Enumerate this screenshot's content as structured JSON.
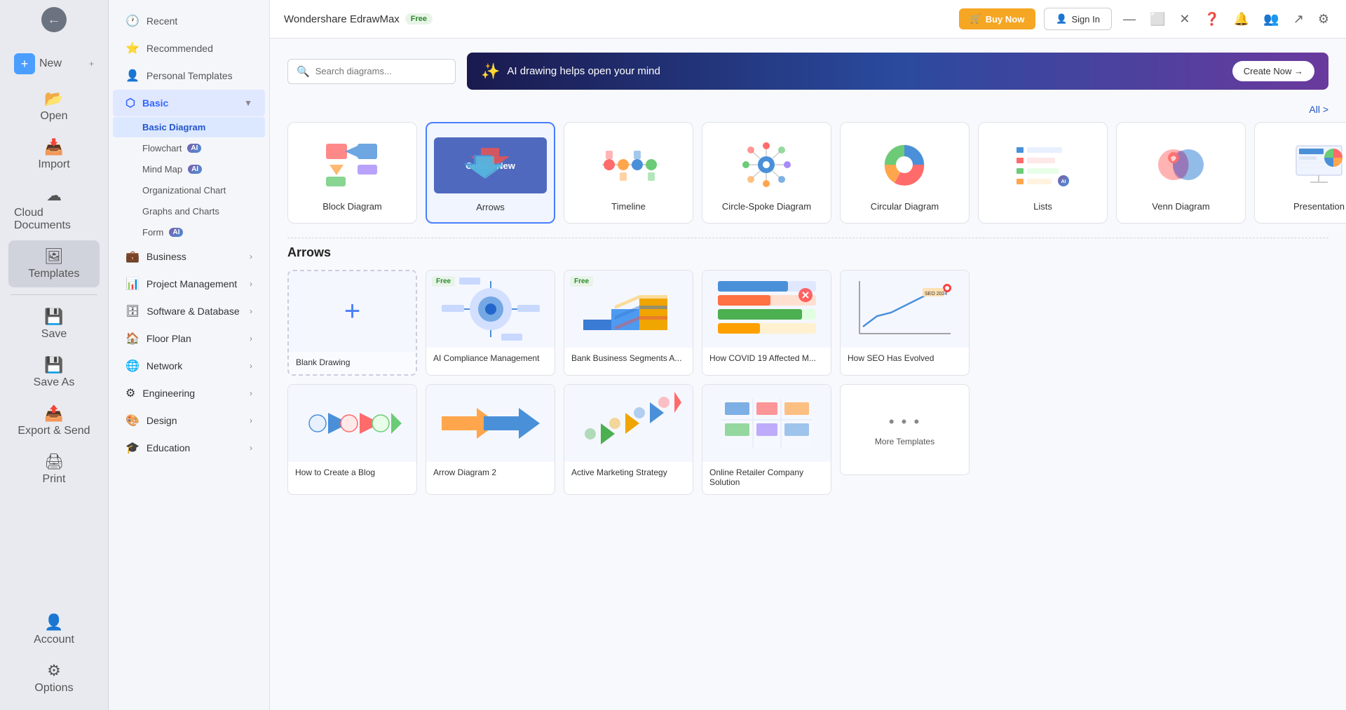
{
  "app": {
    "title": "Wondershare EdrawMax",
    "free_label": "Free",
    "buy_now": "Buy Now",
    "sign_in": "Sign In"
  },
  "search": {
    "placeholder": "Search diagrams..."
  },
  "ai_banner": {
    "text": "AI drawing helps open your mind",
    "cta": "Create Now →"
  },
  "all_link": "All >",
  "icon_nav": [
    {
      "id": "new",
      "label": "New",
      "icon": "✚"
    },
    {
      "id": "open",
      "label": "Open",
      "icon": "📂"
    },
    {
      "id": "import",
      "label": "Import",
      "icon": "📥"
    },
    {
      "id": "cloud",
      "label": "Cloud Documents",
      "icon": "☁"
    },
    {
      "id": "templates",
      "label": "Templates",
      "icon": "🖼"
    },
    {
      "id": "save",
      "label": "Save",
      "icon": "💾"
    },
    {
      "id": "saveas",
      "label": "Save As",
      "icon": "💾"
    },
    {
      "id": "export",
      "label": "Export & Send",
      "icon": "📤"
    },
    {
      "id": "print",
      "label": "Print",
      "icon": "🖨"
    }
  ],
  "nav": {
    "top_items": [
      {
        "id": "recent",
        "label": "Recent",
        "icon": "🕐"
      },
      {
        "id": "recommended",
        "label": "Recommended",
        "icon": "⭐"
      },
      {
        "id": "personal",
        "label": "Personal Templates",
        "icon": "👤"
      }
    ],
    "categories": [
      {
        "id": "basic",
        "label": "Basic",
        "expanded": true,
        "active": true,
        "sub_items": [
          {
            "id": "basic-diagram",
            "label": "Basic Diagram",
            "active": true
          },
          {
            "id": "flowchart",
            "label": "Flowchart",
            "ai": true
          },
          {
            "id": "mind-map",
            "label": "Mind Map",
            "ai": true
          },
          {
            "id": "org-chart",
            "label": "Organizational Chart"
          },
          {
            "id": "graphs",
            "label": "Graphs and Charts"
          },
          {
            "id": "form",
            "label": "Form",
            "ai": true
          }
        ]
      },
      {
        "id": "business",
        "label": "Business",
        "expanded": false
      },
      {
        "id": "project",
        "label": "Project Management",
        "expanded": false
      },
      {
        "id": "software",
        "label": "Software & Database",
        "expanded": false
      },
      {
        "id": "floor",
        "label": "Floor Plan",
        "expanded": false
      },
      {
        "id": "network",
        "label": "Network",
        "expanded": false
      },
      {
        "id": "engineering",
        "label": "Engineering",
        "expanded": false
      },
      {
        "id": "design",
        "label": "Design",
        "expanded": false
      },
      {
        "id": "education",
        "label": "Education",
        "expanded": false
      }
    ]
  },
  "diagram_types": [
    {
      "id": "block",
      "label": "Block Diagram",
      "selected": false
    },
    {
      "id": "arrows",
      "label": "Arrows",
      "selected": true
    },
    {
      "id": "timeline",
      "label": "Timeline",
      "selected": false
    },
    {
      "id": "circle-spoke",
      "label": "Circle-Spoke Diagram",
      "selected": false
    },
    {
      "id": "circular",
      "label": "Circular Diagram",
      "selected": false
    },
    {
      "id": "lists",
      "label": "Lists",
      "selected": false
    },
    {
      "id": "venn",
      "label": "Venn Diagram",
      "selected": false
    },
    {
      "id": "presentation",
      "label": "Presentation",
      "selected": false
    }
  ],
  "create_new_label": "Create New",
  "arrows_section": {
    "title": "Arrows",
    "templates": [
      {
        "id": "blank",
        "label": "Blank Drawing",
        "blank": true
      },
      {
        "id": "ai-compliance",
        "label": "AI Compliance Management",
        "free": true
      },
      {
        "id": "bank-segments",
        "label": "Bank Business Segments A...",
        "free": true
      },
      {
        "id": "covid19",
        "label": "How COVID 19 Affected M..."
      },
      {
        "id": "seo",
        "label": "How SEO Has Evolved"
      }
    ],
    "row2": [
      {
        "id": "blog",
        "label": "How to Create a Blog"
      },
      {
        "id": "arrow2",
        "label": "Arrow Diagram 2"
      },
      {
        "id": "marketing",
        "label": "Active Marketing Strategy"
      },
      {
        "id": "company",
        "label": "Online Retailer Company Solution"
      },
      {
        "id": "more",
        "label": "More Templates",
        "more": true
      }
    ]
  },
  "bottom_nav": [
    {
      "id": "account",
      "label": "Account",
      "icon": "👤"
    },
    {
      "id": "options",
      "label": "Options",
      "icon": "⚙"
    }
  ]
}
